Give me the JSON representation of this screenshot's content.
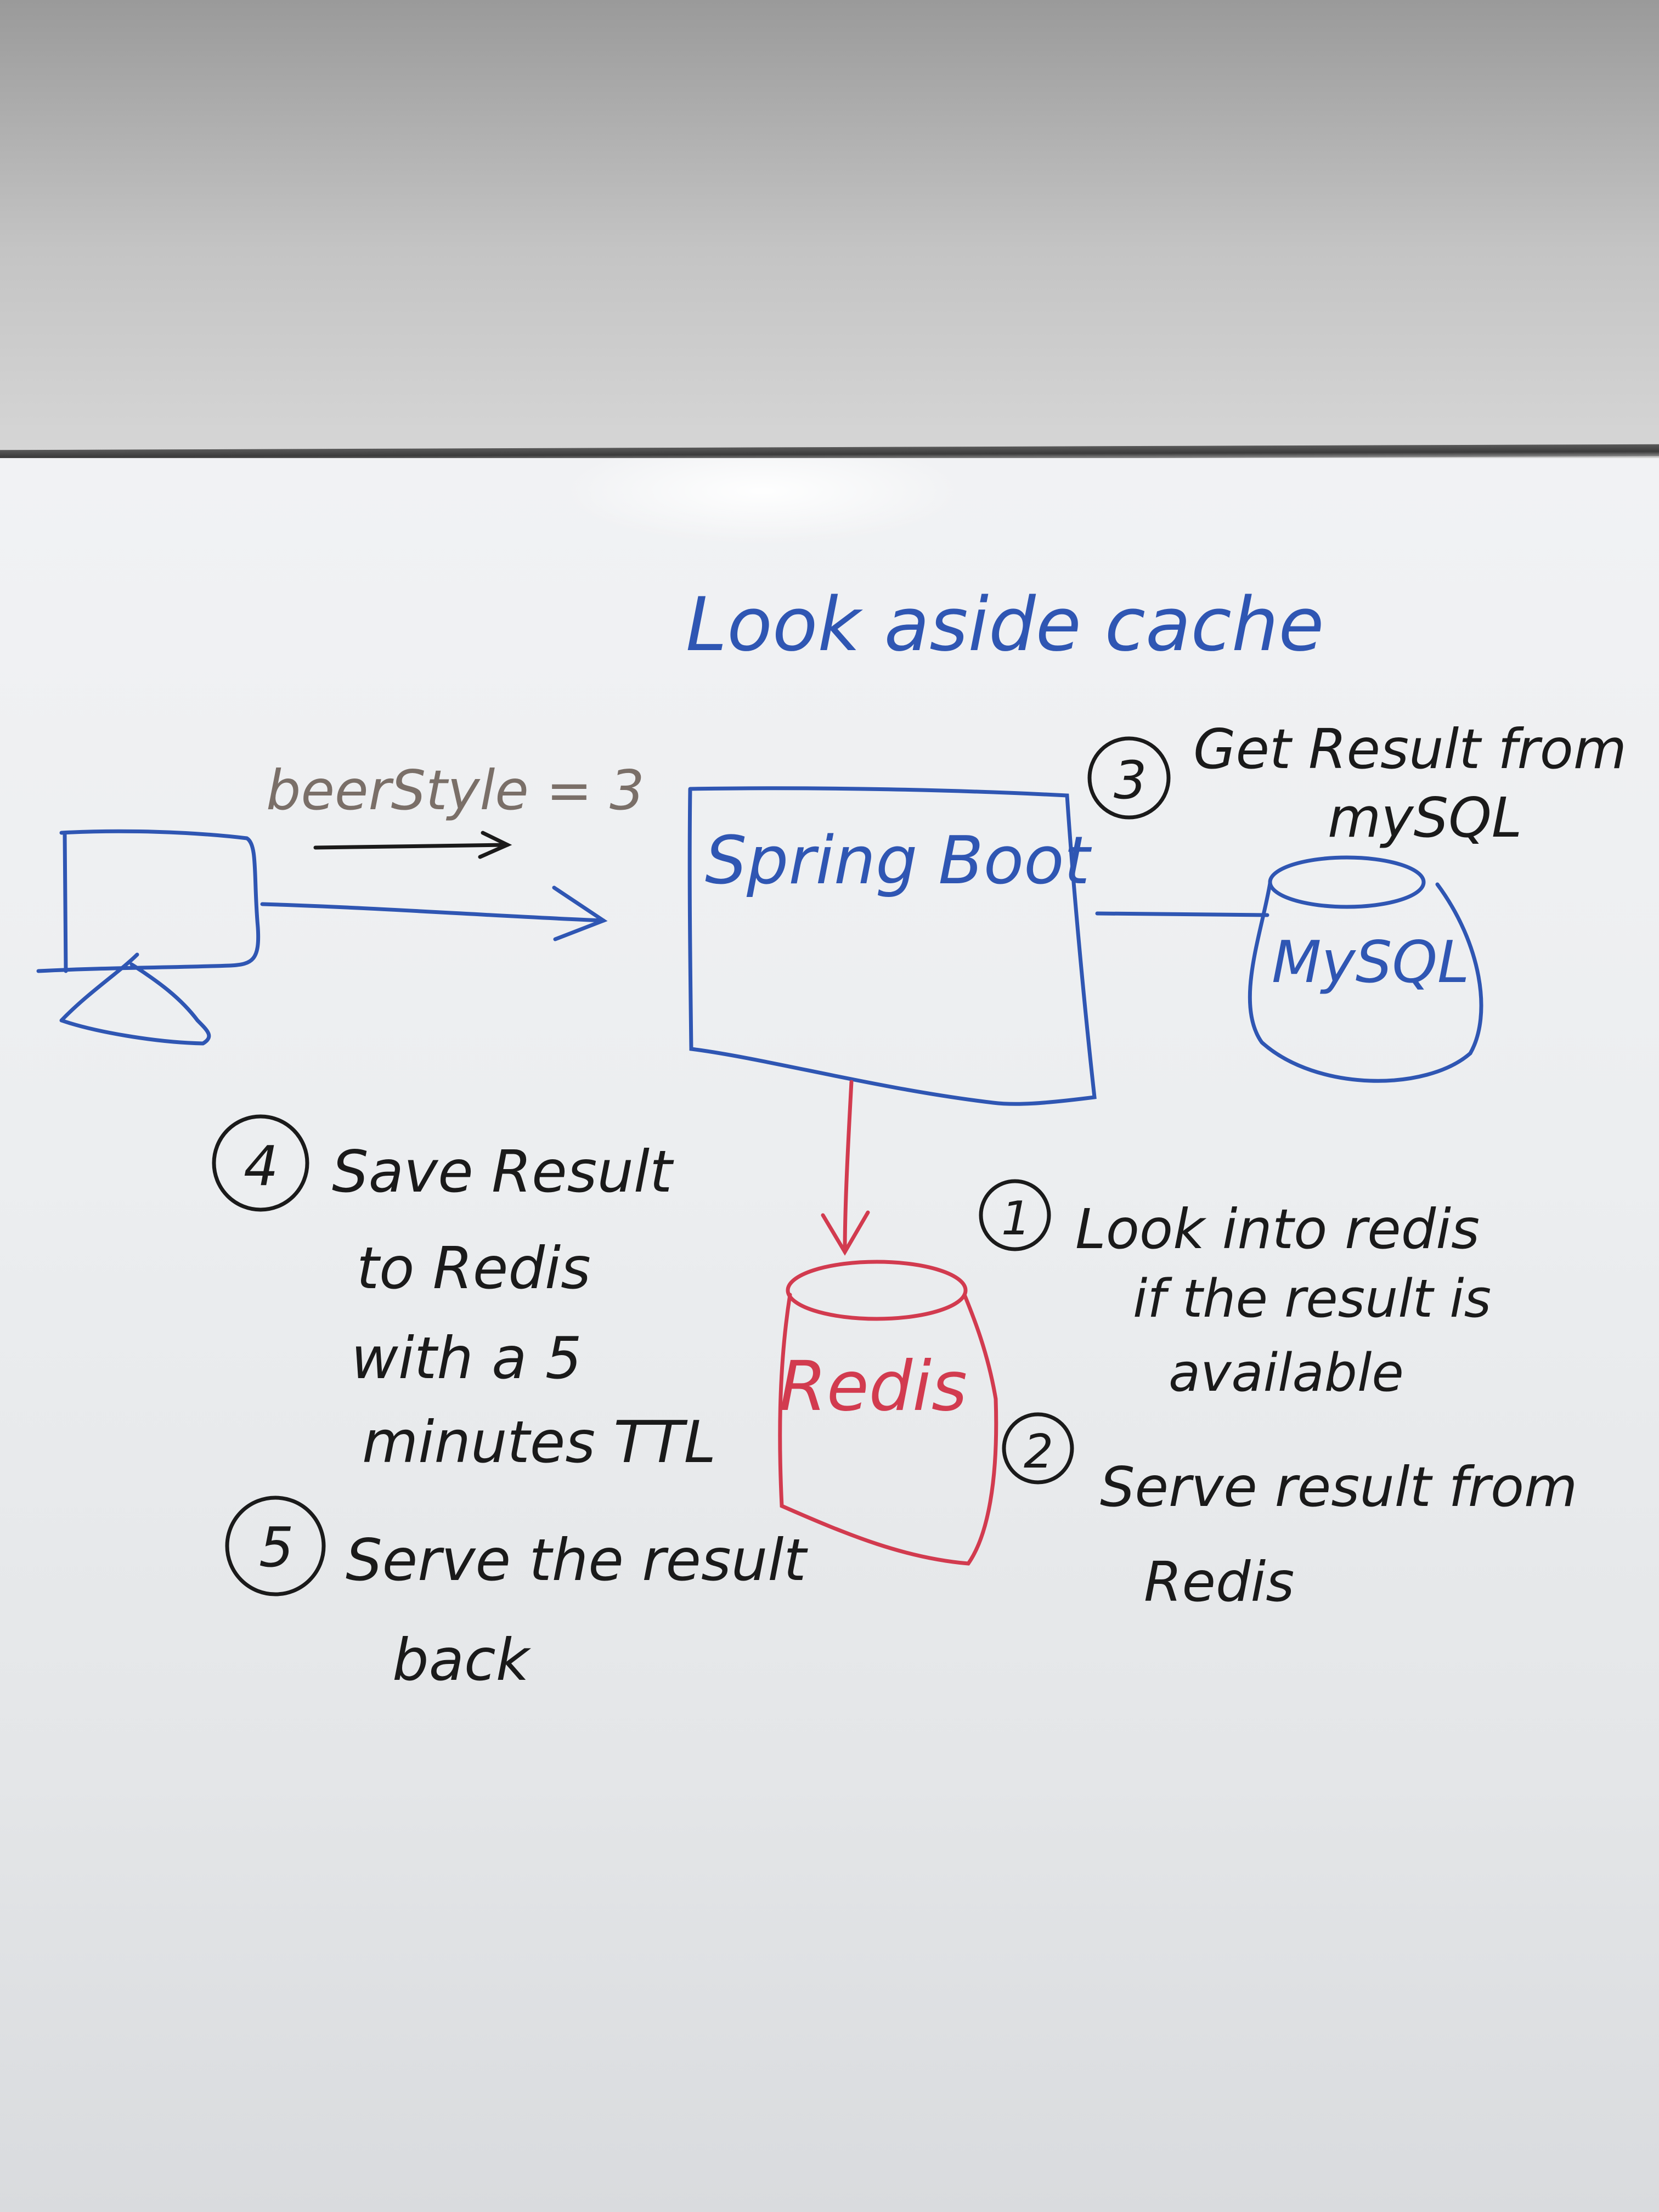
{
  "title": "Look aside cache",
  "request_label": "beerStyle = 3",
  "components": {
    "app": "Spring Boot",
    "database": "MySQL",
    "cache": "Redis"
  },
  "steps": [
    {
      "number": "1",
      "lines": [
        "Look into redis",
        "if the result is",
        "available"
      ]
    },
    {
      "number": "2",
      "lines": [
        "Serve result from",
        "Redis"
      ]
    },
    {
      "number": "3",
      "lines": [
        "Get Result from",
        "mySQL"
      ]
    },
    {
      "number": "4",
      "lines": [
        "Save Result",
        "to Redis",
        "with a 5",
        "minutes TTL"
      ]
    },
    {
      "number": "5",
      "lines": [
        "Serve the result",
        "back"
      ]
    }
  ],
  "colors": {
    "blue_marker": "#2f56b3",
    "red_marker": "#d23b4f",
    "black_marker": "#1a1a1a"
  },
  "icons": {
    "client": "computer-monitor-icon",
    "database": "database-cylinder-icon",
    "cache": "cache-cylinder-icon"
  }
}
